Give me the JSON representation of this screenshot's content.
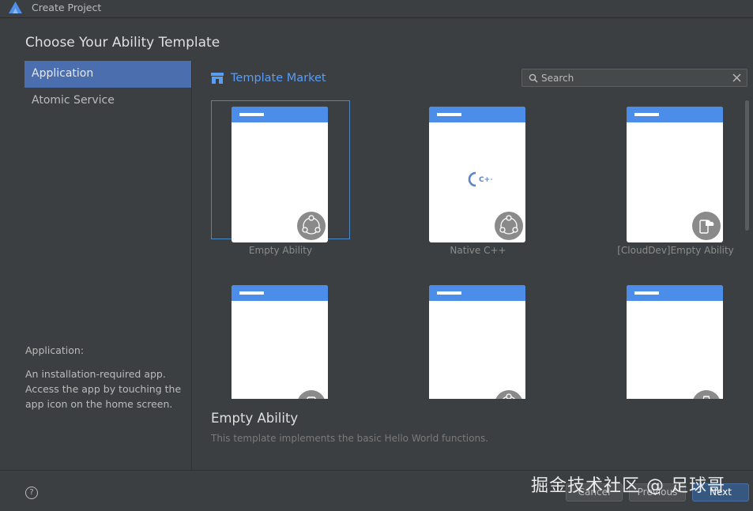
{
  "window": {
    "title": "Create Project"
  },
  "heading": "Choose Your Ability Template",
  "sidebar": {
    "items": [
      {
        "label": "Application",
        "selected": true
      },
      {
        "label": "Atomic Service",
        "selected": false
      }
    ]
  },
  "description": {
    "title": "Application:",
    "body": "An installation-required app. Access the app by touching the app icon on the home screen."
  },
  "market": {
    "label": "Template Market",
    "icon": "store-icon"
  },
  "search": {
    "placeholder": "Search",
    "value": ""
  },
  "templates": [
    {
      "label": "Empty Ability",
      "selected": true,
      "badge": "ability-icon"
    },
    {
      "label": "Native C++",
      "selected": false,
      "badge": "ability-icon",
      "logo": "C++"
    },
    {
      "label": "[CloudDev]Empty Ability",
      "selected": false,
      "badge": "cloud-device-icon"
    },
    {
      "label": "",
      "selected": false,
      "badge": "phone-icon"
    },
    {
      "label": "",
      "selected": false,
      "badge": "ability-icon"
    },
    {
      "label": "",
      "selected": false,
      "badge": "watch-icon"
    }
  ],
  "selected_template": {
    "name": "Empty Ability",
    "description": "This template implements the basic Hello World functions."
  },
  "footer": {
    "help": "?",
    "cancel": "Cancel",
    "previous": "Previous",
    "next": "Next"
  },
  "watermark": "掘金技术社区 @ 足球哥",
  "colors": {
    "accent": "#4b6eaf",
    "link": "#589df6",
    "phone_bar": "#4b8de8",
    "background": "#3c3f41"
  }
}
